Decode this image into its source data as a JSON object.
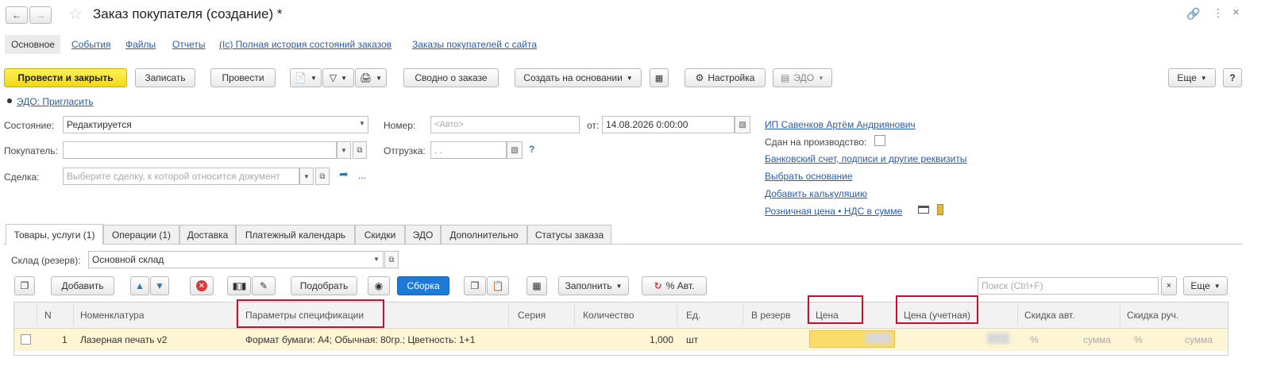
{
  "window": {
    "title": "Заказ покупателя (создание) *"
  },
  "nav_tabs": [
    "Основное",
    "События",
    "Файлы",
    "Отчеты",
    "(Іс) Полная история состояний заказов",
    "Заказы покупателей с сайта"
  ],
  "toolbar": {
    "post_close": "Провести и закрыть",
    "save": "Записать",
    "post": "Провести",
    "summary": "Сводно о заказе",
    "create_based": "Создать на основании",
    "settings": "Настройка",
    "edo": "ЭДО",
    "more": "Еще",
    "help": "?"
  },
  "edo_invite": "ЭДО: Пригласить",
  "form": {
    "state_label": "Состояние:",
    "state_value": "Редактируется",
    "buyer_label": "Покупатель:",
    "buyer_value": "",
    "deal_label": "Сделка:",
    "deal_placeholder": "Выберите сделку, к которой относится документ",
    "number_label": "Номер:",
    "number_placeholder": "<Авто>",
    "shipment_label": "Отгрузка:",
    "shipment_value": ". .",
    "from_label": "от:",
    "date_value": "14.08.2026  0:00:00",
    "help_mark": "?",
    "ellipsis": "..."
  },
  "right_panel": {
    "org": "ИП Савенков Артём Андриянович",
    "production_label": "Сдан на производство:",
    "bank_link": "Банковский счет, подписи и другие реквизиты",
    "choose_basis": "Выбрать основание",
    "add_calc": "Добавить калькуляцию",
    "price_link": "Розничная цена • НДС в сумме"
  },
  "section_tabs": [
    "Товары, услуги (1)",
    "Операции (1)",
    "Доставка",
    "Платежный календарь",
    "Скидки",
    "ЭДО",
    "Дополнительно",
    "Статусы заказа"
  ],
  "warehouse": {
    "label": "Склад (резерв):",
    "value": "Основной склад"
  },
  "table_toolbar": {
    "add": "Добавить",
    "pick": "Подобрать",
    "assembly": "Сборка",
    "fill": "Заполнить",
    "auto_pct": "% Авт.",
    "search_placeholder": "Поиск (Ctrl+F)",
    "clear": "×",
    "more": "Еще"
  },
  "table": {
    "columns": [
      "N",
      "Номенклатура",
      "Параметры спецификации",
      "Серия",
      "Количество",
      "Ед.",
      "В резерв",
      "Цена",
      "Цена (учетная)",
      "Скидка авт.",
      "Скидка руч."
    ],
    "rows": [
      {
        "n": "1",
        "item": "Лазерная печать v2",
        "spec": "Формат бумаги: А4; Обычная: 80гр.; Цветность: 1+1",
        "series": "",
        "qty": "1,000",
        "unit": "шт",
        "reserve": "",
        "price": "",
        "price_acc": "",
        "disc_auto_pct": "%",
        "disc_auto_sum": "сумма",
        "disc_man_pct": "%",
        "disc_man_sum": "сумма"
      }
    ]
  },
  "colors": {
    "highlight_box": "#c8102e",
    "row_bg": "#fdf5d3",
    "price_cell": "#f9dc6a",
    "link": "#2a5caa"
  }
}
